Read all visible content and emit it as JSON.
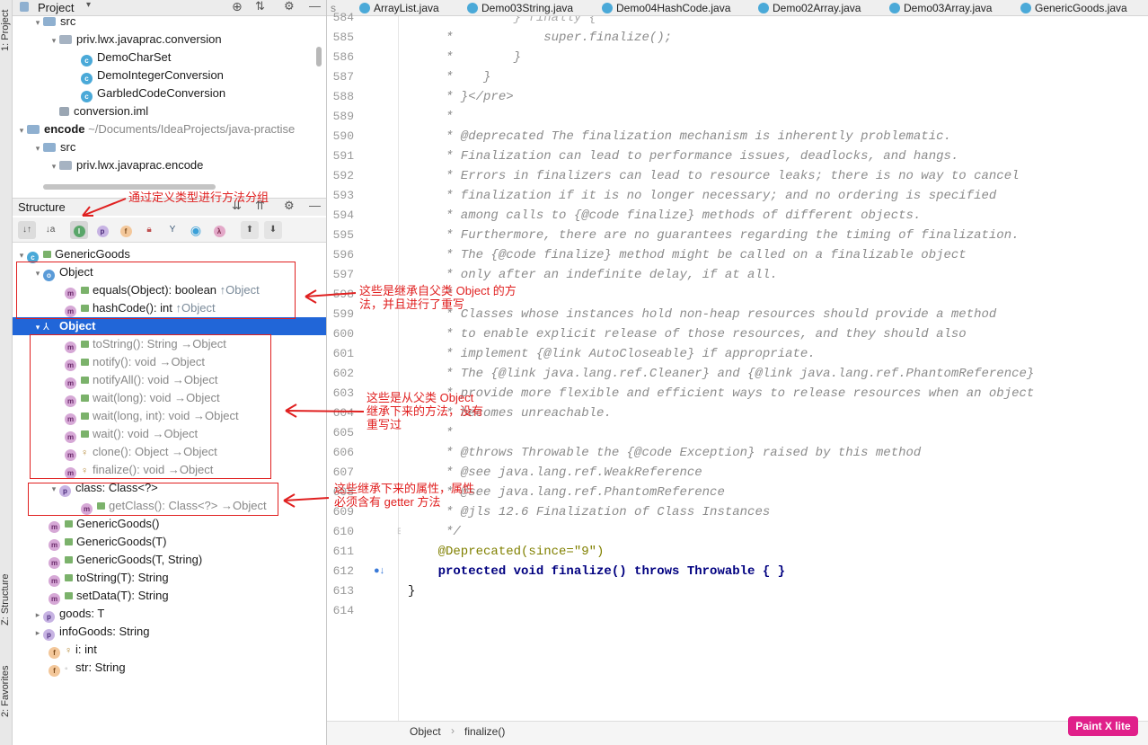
{
  "side_tabs": {
    "project": "1: Project",
    "structure": "Z: Structure",
    "favorites": "2: Favorites"
  },
  "project_panel": {
    "title": "Project",
    "rows": [
      {
        "label": "src",
        "kind": "folder"
      },
      {
        "label": "priv.lwx.javaprac.conversion",
        "kind": "package"
      },
      {
        "label": "DemoCharSet",
        "kind": "class"
      },
      {
        "label": "DemoIntegerConversion",
        "kind": "class"
      },
      {
        "label": "GarbledCodeConversion",
        "kind": "class"
      },
      {
        "label": "conversion.iml",
        "kind": "file"
      },
      {
        "label": "encode",
        "path": "~/Documents/IdeaProjects/java-practise",
        "kind": "module"
      },
      {
        "label": "src",
        "kind": "folder"
      },
      {
        "label": "priv.lwx.javaprac.encode",
        "kind": "package"
      }
    ]
  },
  "structure_panel": {
    "title": "Structure",
    "toolbar_hint": "通过定义类型进行方法分组",
    "root": "GenericGoods",
    "groups": [
      {
        "label": "Object",
        "items": [
          {
            "label": "equals(Object): boolean",
            "origin": "↑Object"
          },
          {
            "label": "hashCode(): int",
            "origin": "↑Object"
          }
        ]
      },
      {
        "label": "Object",
        "selected": true,
        "items": [
          {
            "label": "toString(): String",
            "origin": "→Object"
          },
          {
            "label": "notify(): void",
            "origin": "→Object"
          },
          {
            "label": "notifyAll(): void",
            "origin": "→Object"
          },
          {
            "label": "wait(long): void",
            "origin": "→Object"
          },
          {
            "label": "wait(long, int): void",
            "origin": "→Object"
          },
          {
            "label": "wait(): void",
            "origin": "→Object"
          },
          {
            "label": "clone(): Object",
            "origin": "→Object"
          },
          {
            "label": "finalize(): void",
            "origin": "→Object"
          }
        ]
      },
      {
        "label": "class: Class<?>",
        "items": [
          {
            "label": "getClass(): Class<?>",
            "origin": "→Object"
          }
        ]
      }
    ],
    "members": [
      {
        "label": "GenericGoods()",
        "icon": "m"
      },
      {
        "label": "GenericGoods(T)",
        "icon": "m"
      },
      {
        "label": "GenericGoods(T, String)",
        "icon": "m"
      },
      {
        "label": "toString(T): String",
        "icon": "m"
      },
      {
        "label": "setData(T): String",
        "icon": "m"
      },
      {
        "label": "goods: T",
        "icon": "p"
      },
      {
        "label": "infoGoods: String",
        "icon": "p"
      },
      {
        "label": "i: int",
        "icon": "f"
      },
      {
        "label": "str: String",
        "icon": "f"
      }
    ]
  },
  "editor": {
    "tabs": [
      "ArrayList.java",
      "Demo03String.java",
      "Demo04HashCode.java",
      "Demo02Array.java",
      "Demo03Array.java",
      "GenericGoods.java"
    ],
    "first_line_partial": "584",
    "lines": [
      {
        "n": "585",
        "text": "     *            super.finalize();"
      },
      {
        "n": "586",
        "text": "     *        }"
      },
      {
        "n": "587",
        "text": "     *    }"
      },
      {
        "n": "588",
        "text": "     * }</pre>"
      },
      {
        "n": "589",
        "text": "     *"
      },
      {
        "n": "590",
        "text": "     * @deprecated The finalization mechanism is inherently problematic."
      },
      {
        "n": "591",
        "text": "     * Finalization can lead to performance issues, deadlocks, and hangs."
      },
      {
        "n": "592",
        "text": "     * Errors in finalizers can lead to resource leaks; there is no way to cancel"
      },
      {
        "n": "593",
        "text": "     * finalization if it is no longer necessary; and no ordering is specified"
      },
      {
        "n": "594",
        "text": "     * among calls to {@code finalize} methods of different objects."
      },
      {
        "n": "595",
        "text": "     * Furthermore, there are no guarantees regarding the timing of finalization."
      },
      {
        "n": "596",
        "text": "     * The {@code finalize} method might be called on a finalizable object"
      },
      {
        "n": "597",
        "text": "     * only after an indefinite delay, if at all."
      },
      {
        "n": "598",
        "text": "     *"
      },
      {
        "n": "599",
        "text": "     * Classes whose instances hold non-heap resources should provide a method"
      },
      {
        "n": "600",
        "text": "     * to enable explicit release of those resources, and they should also"
      },
      {
        "n": "601",
        "text": "     * implement {@link AutoCloseable} if appropriate."
      },
      {
        "n": "602",
        "text": "     * The {@link java.lang.ref.Cleaner} and {@link java.lang.ref.PhantomReference}"
      },
      {
        "n": "603",
        "text": "     * provide more flexible and efficient ways to release resources when an object"
      },
      {
        "n": "604",
        "text": "     * becomes unreachable."
      },
      {
        "n": "605",
        "text": "     *"
      },
      {
        "n": "606",
        "text": "     * @throws Throwable the {@code Exception} raised by this method"
      },
      {
        "n": "607",
        "text": "     * @see java.lang.ref.WeakReference"
      },
      {
        "n": "608",
        "text": "     * @see java.lang.ref.PhantomReference"
      },
      {
        "n": "609",
        "text": "     * @jls 12.6 Finalization of Class Instances"
      },
      {
        "n": "610",
        "text": "     */"
      },
      {
        "n": "611",
        "text": "    @Deprecated(since=\"9\")"
      },
      {
        "n": "612",
        "text": "    protected void finalize() throws Throwable { }"
      },
      {
        "n": "613",
        "text": "}"
      },
      {
        "n": "614",
        "text": ""
      }
    ],
    "breadcrumb": [
      "Object",
      "finalize()"
    ]
  },
  "annotations": {
    "inherited_overridden": [
      "这些是继承自父类 Object 的方",
      "法，并且进行了重写"
    ],
    "inherited_not_overridden": [
      "这些是从父类 Object",
      "继承下来的方法，没有",
      "重写过"
    ],
    "inherited_properties": [
      "这些继承下来的属性，属性",
      "必须含有 getter 方法"
    ]
  },
  "watermark": "Paint X lite",
  "colors": {
    "selection": "#2166d8",
    "annotation": "#e02020",
    "keyword": "#000080",
    "string": "#067d17"
  }
}
